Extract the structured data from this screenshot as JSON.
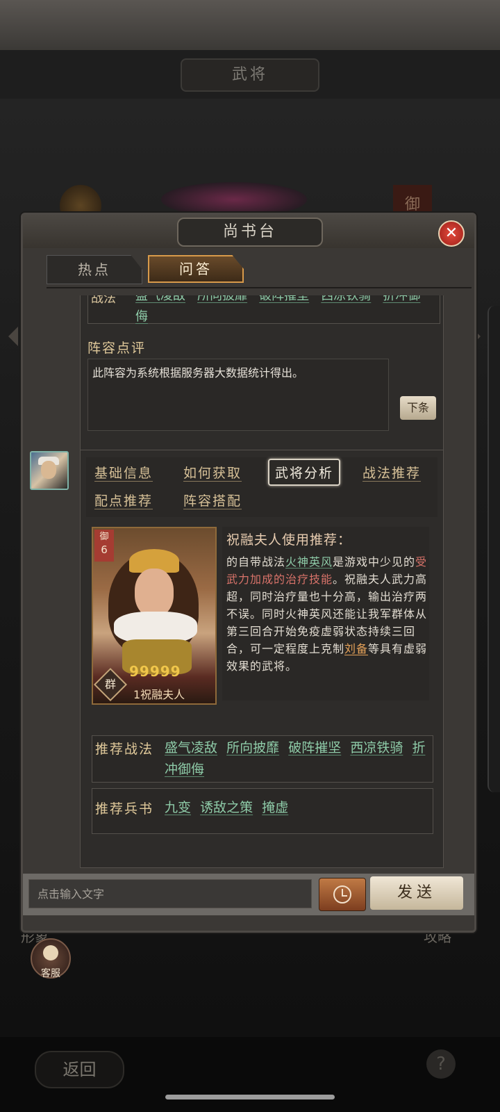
{
  "background": {
    "screen_title": "武将",
    "bottom_left_label": "形象",
    "bottom_right_label": "攻略",
    "back_label": "返回",
    "help_label": "?",
    "right_badge": "御"
  },
  "dialog": {
    "title": "尚书台",
    "close_icon": "✕",
    "tabs": [
      {
        "label": "热点",
        "active": false
      },
      {
        "label": "问答",
        "active": true
      }
    ]
  },
  "prev_message": {
    "skills_label": "战法",
    "skills": [
      "盛气凌敌",
      "所向披靡",
      "破阵摧坚",
      "西凉铁骑",
      "折冲御侮"
    ],
    "review_title": "阵容点评",
    "review_text": "此阵容为系统根据服务器大数据统计得出。",
    "next_label": "下条"
  },
  "answer": {
    "question_buttons": [
      {
        "label": "基础信息",
        "active": false
      },
      {
        "label": "如何获取",
        "active": false
      },
      {
        "label": "武将分析",
        "active": true
      },
      {
        "label": "战法推荐",
        "active": false
      },
      {
        "label": "配点推荐",
        "active": false
      },
      {
        "label": "阵容搭配",
        "active": false
      }
    ],
    "card": {
      "rank_label": "御",
      "rank_value": "6",
      "stars": "99999",
      "faction": "群",
      "name": "1祝融夫人"
    },
    "desc_title": "祝融夫人使用推荐：",
    "desc": {
      "p1": "的自带战法",
      "skill1": "火神英风",
      "p2": "是游戏中少见的",
      "red": "受武力加成的治疗技能",
      "p3": "。祝融夫人武力高超，同时治疗量也十分高，输出治疗两不误。同时火神英风还能让我军群体从第三回合开始免疫虚弱状态持续三回合，可一定程度上克制",
      "hero": "刘备",
      "p4": "等具有虚弱效果的武将。"
    },
    "rec_skills_label": "推荐战法",
    "rec_skills": [
      "盛气凌敌",
      "所向披靡",
      "破阵摧坚",
      "西凉铁骑",
      "折冲御侮"
    ],
    "rec_books_label": "推荐兵书",
    "rec_books": [
      "九变",
      "诱敌之策",
      "掩虚"
    ]
  },
  "input": {
    "placeholder": "点击输入文字",
    "send_label": "发送"
  },
  "customer_service": {
    "label": "客服"
  }
}
